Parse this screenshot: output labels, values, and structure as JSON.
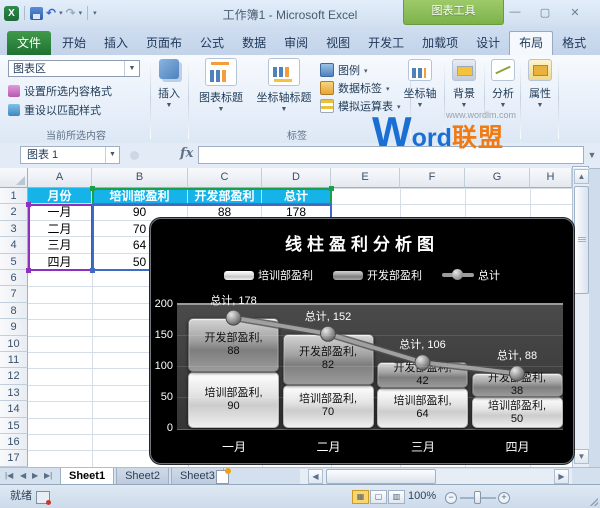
{
  "titlebar": {
    "title": "工作簿1 - Microsoft Excel",
    "context_header": "图表工具"
  },
  "ribbon_tabs": {
    "file": "文件",
    "tabs": [
      "开始",
      "插入",
      "页面布",
      "公式",
      "数据",
      "审阅",
      "视图",
      "开发工",
      "加载项",
      "设计",
      "布局",
      "格式"
    ],
    "active": "布局"
  },
  "ribbon": {
    "current_selection": {
      "combo": "图表区",
      "format_btn": "设置所选内容格式",
      "reset_btn": "重设以匹配样式",
      "group": "当前所选内容"
    },
    "insert_btn": "插入",
    "labels": {
      "chart_title": "图表标题",
      "axis_title": "坐标轴标题",
      "legend": "图例",
      "data_labels": "数据标签",
      "data_table": "模拟运算表",
      "group": "标签"
    },
    "axes_btn": "坐标轴",
    "background_btn": "背景",
    "analysis_btn": "分析",
    "properties_btn": "属性"
  },
  "watermark": {
    "url": "www.wordlm.com",
    "brand_w": "W",
    "brand_rest": "ord",
    "brand_cn": "联盟"
  },
  "formula_bar": {
    "name_box": "图表 1",
    "fx": "fx",
    "value": ""
  },
  "grid": {
    "columns": [
      "A",
      "B",
      "C",
      "D",
      "E",
      "F",
      "G",
      "H"
    ],
    "row_count": 17,
    "table": {
      "headers": [
        "月份",
        "培训部盈利",
        "开发部盈利",
        "总计"
      ],
      "rows": [
        [
          "一月",
          90,
          88,
          178
        ],
        [
          "二月",
          70,
          82,
          152
        ],
        [
          "三月",
          64,
          42,
          106
        ],
        [
          "四月",
          50,
          38,
          88
        ]
      ]
    }
  },
  "chart_data": {
    "type": "bar",
    "subtype": "stacked-column-with-line",
    "title": "线柱盈利分析图",
    "categories": [
      "一月",
      "二月",
      "三月",
      "四月"
    ],
    "series": [
      {
        "name": "培训部盈利",
        "type": "bar",
        "values": [
          90,
          70,
          64,
          50
        ]
      },
      {
        "name": "开发部盈利",
        "type": "bar",
        "values": [
          88,
          82,
          42,
          38
        ]
      },
      {
        "name": "总计",
        "type": "line",
        "values": [
          178,
          152,
          106,
          88
        ]
      }
    ],
    "ylim": [
      0,
      200
    ],
    "yticks": [
      0,
      50,
      100,
      150,
      200
    ],
    "legend_position": "top",
    "background": "#000000",
    "plot_background": "#3f3f3f"
  },
  "sheet_tabs": {
    "tabs": [
      "Sheet1",
      "Sheet2",
      "Sheet3"
    ],
    "active": "Sheet1"
  },
  "status_bar": {
    "mode": "就绪",
    "zoom": "100%"
  },
  "colors": {
    "table_header_fill": "#16b3e8",
    "selection_blue": "#3f6bc4",
    "selection_purple": "#8e2fbf",
    "selection_green": "#1e9e4b",
    "watermark_blue": "#1a6fd4",
    "watermark_orange": "#f07a13",
    "file_tab_green": "#1f7233",
    "chart_tools_green": "#7cb24a"
  }
}
